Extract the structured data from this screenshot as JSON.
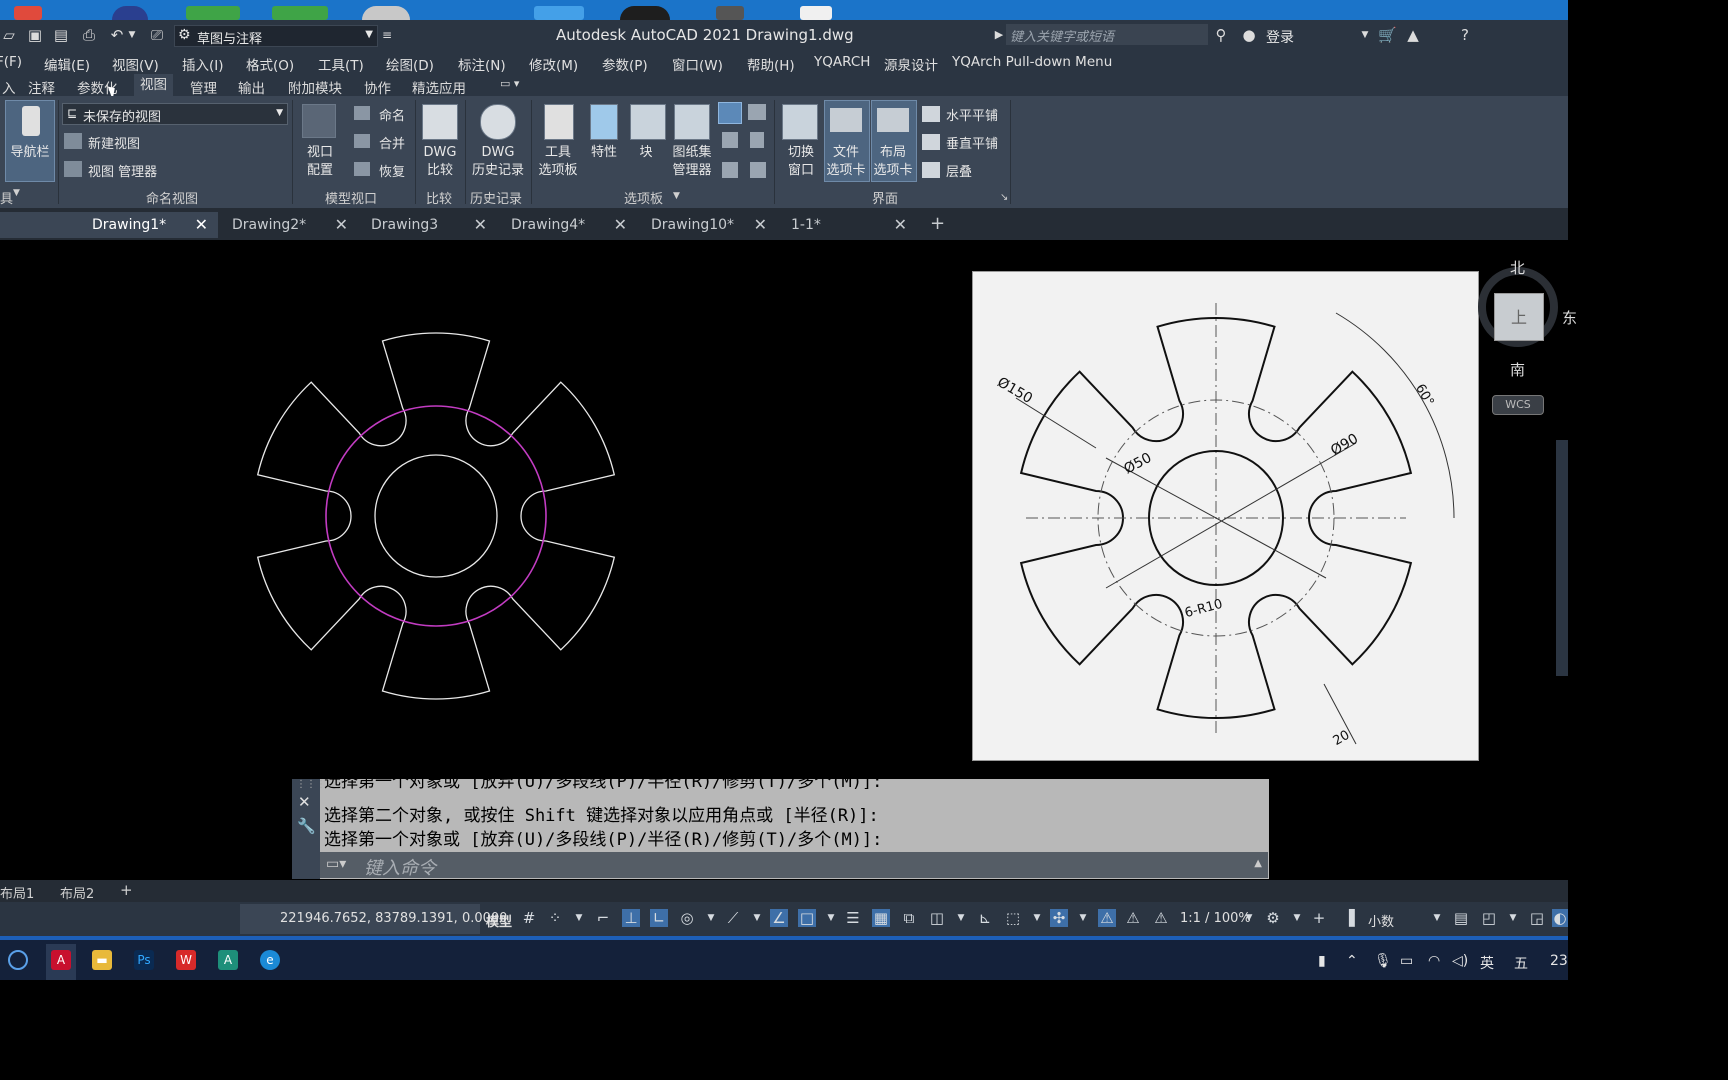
{
  "window": {
    "title": "Autodesk AutoCAD 2021    Drawing1.dwg",
    "workspace": "草图与注释",
    "search_placeholder": "键入关键字或短语",
    "login": "登录"
  },
  "menu": [
    "F(F)",
    "编辑(E)",
    "视图(V)",
    "插入(I)",
    "格式(O)",
    "工具(T)",
    "绘图(D)",
    "标注(N)",
    "修改(M)",
    "参数(P)",
    "窗口(W)",
    "帮助(H)",
    "YQARCH",
    "源泉设计",
    "YQArch Pull-down Menu"
  ],
  "ribbon_tabs": [
    "入",
    "注释",
    "参数化",
    "视图",
    "管理",
    "输出",
    "附加模块",
    "协作",
    "精选应用"
  ],
  "ribbon_active_tab": "视图",
  "ribbon": {
    "nav_bar": "导航栏",
    "named_view_select": "未保存的视图",
    "new_view": "新建视图",
    "view_manager": "视图 管理器",
    "named_views_panel": "命名视图",
    "rename": "命名",
    "join": "合并",
    "restore": "恢复",
    "viewport_config_1": "视口",
    "viewport_config_2": "配置",
    "model_viewports_panel": "模型视口",
    "dwg_compare_1": "DWG",
    "dwg_compare_2": "比较",
    "compare_panel": "比较",
    "dwg_history_1": "DWG",
    "dwg_history_2": "历史记录",
    "history_panel": "历史记录",
    "tool_palettes_1": "工具",
    "tool_palettes_2": "选项板",
    "properties": "特性",
    "block": "块",
    "sheet_set_1": "图纸集",
    "sheet_set_2": "管理器",
    "palettes_panel": "选项板",
    "switch_window_1": "切换",
    "switch_window_2": "窗口",
    "file_tabs_1": "文件",
    "file_tabs_2": "选项卡",
    "layout_tabs_1": "布局",
    "layout_tabs_2": "选项卡",
    "tile_h": "水平平铺",
    "tile_v": "垂直平铺",
    "cascade": "层叠",
    "interface_panel": "界面",
    "left_panel_foot": "具"
  },
  "doc_tabs": [
    {
      "label": "Drawing1*",
      "active": true
    },
    {
      "label": "Drawing2*",
      "active": false
    },
    {
      "label": "Drawing3",
      "active": false
    },
    {
      "label": "Drawing4*",
      "active": false
    },
    {
      "label": "Drawing10*",
      "active": false
    },
    {
      "label": "1-1*",
      "active": false
    }
  ],
  "viewcube": {
    "north": "北",
    "south": "南",
    "east": "东",
    "top_face": "上",
    "wcs": "WCS"
  },
  "reference_drawing": {
    "dims": [
      "Ø150",
      "Ø50",
      "Ø90",
      "6-R10",
      "60°",
      "20"
    ]
  },
  "command": {
    "line0": "选择第一个对象或 [放弃(U)/多段线(P)/半径(R)/修剪(T)/多个(M)]:",
    "line1": "选择第二个对象, 或按住 Shift 键选择对象以应用角点或 [半径(R)]:",
    "line2": "选择第一个对象或 [放弃(U)/多段线(P)/半径(R)/修剪(T)/多个(M)]:",
    "placeholder": "键入命令"
  },
  "layout_tabs": [
    "布局1",
    "布局2"
  ],
  "status": {
    "coords": "221946.7652, 83789.1391, 0.0000",
    "model": "模型",
    "scale": "1:1 / 100%",
    "units": "小数"
  },
  "taskbar": {
    "ime": "英",
    "ime2": "五",
    "time": "23"
  },
  "colors": {
    "titlebar": "#2b3542",
    "ribbon": "#3b4655",
    "canvas": "#000000",
    "magenta_circle": "#c23cc2",
    "taskbar": "#14213a"
  }
}
